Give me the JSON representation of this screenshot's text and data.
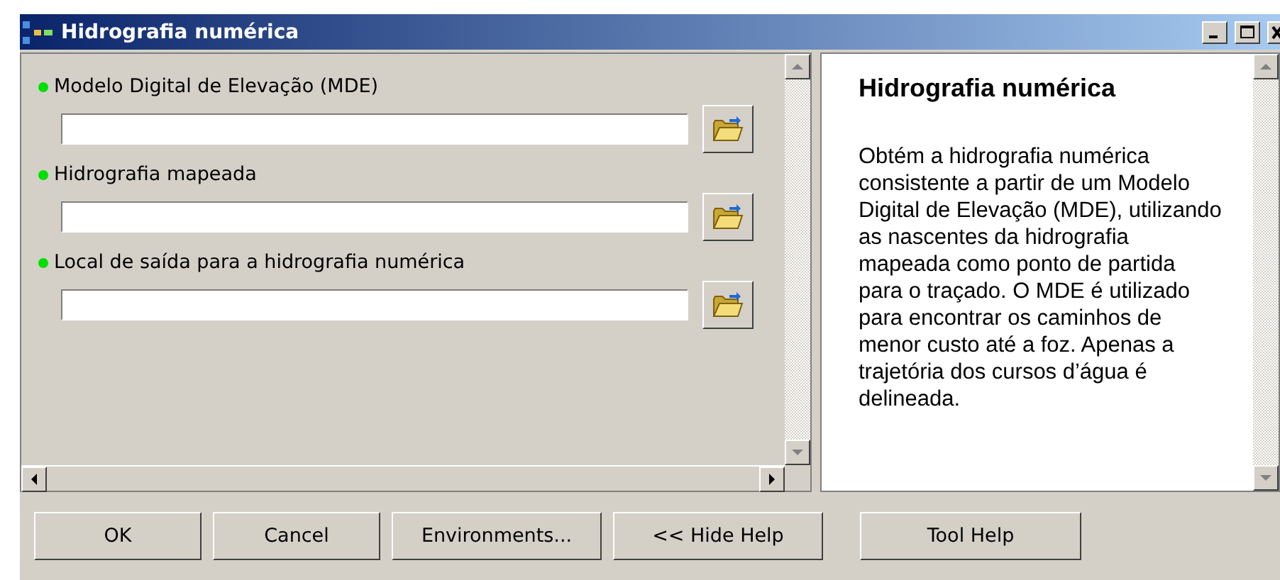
{
  "window": {
    "title": "Hidrografia numérica"
  },
  "parameters": [
    {
      "label": "Modelo Digital de Elevação (MDE)",
      "required": true
    },
    {
      "label": "Hidrografia mapeada",
      "required": true
    },
    {
      "label": "Local de saída para a hidrografia numérica",
      "required": true
    }
  ],
  "help": {
    "title": "Hidrografia numérica",
    "text": "Obtém a hidrografia numérica consistente a partir de um Modelo Digital de Elevação (MDE), utilizando as nascentes da hidrografia mapeada como ponto de partida para o traçado. O MDE é utilizado para encontrar os caminhos de menor custo até a foz. Apenas a trajetória dos cursos d’água é delineada."
  },
  "buttons": [
    {
      "label": "OK",
      "kind": "action"
    },
    {
      "label": "Cancel",
      "kind": "action"
    },
    {
      "label": "Environments...",
      "kind": "action"
    },
    {
      "label": "<< Hide Help",
      "kind": "action"
    },
    {
      "label": "Tool Help",
      "kind": "separated"
    }
  ]
}
